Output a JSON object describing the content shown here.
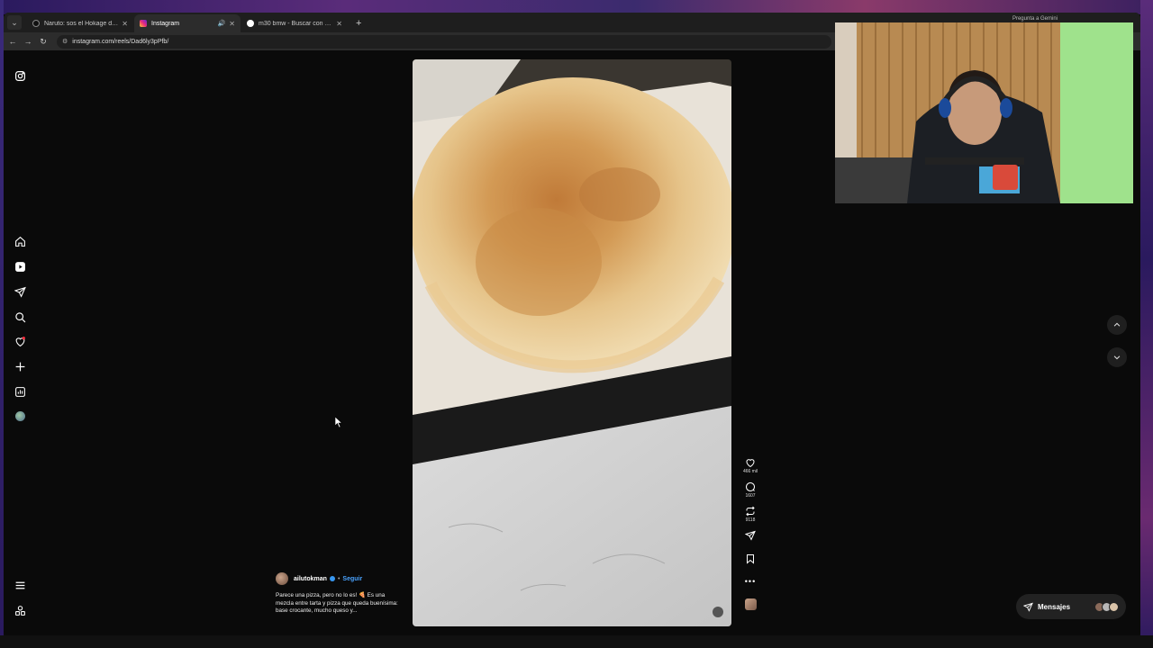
{
  "browser": {
    "tabs": [
      {
        "title": "Naruto: sos el Hokage del stre...",
        "favicon_color": "#1a1a1a",
        "active": false,
        "audio": false
      },
      {
        "title": "Instagram",
        "favicon_color": "#e1306c",
        "active": true,
        "audio": true
      },
      {
        "title": "m30 bmw - Buscar con Google",
        "favicon_color": "#4285f4",
        "active": false,
        "audio": false
      }
    ],
    "new_tab_label": "+",
    "gemini_label": "Pregunta a Gemini",
    "url": "instagram.com/reels/Dad6ly3pPfb/"
  },
  "instagram": {
    "left_nav": [
      {
        "name": "instagram-logo-icon",
        "glyph": "logo"
      },
      {
        "name": "home-icon",
        "glyph": "home"
      },
      {
        "name": "reels-icon",
        "glyph": "reels"
      },
      {
        "name": "direct-icon",
        "glyph": "send"
      },
      {
        "name": "search-icon",
        "glyph": "search"
      },
      {
        "name": "notifications-icon",
        "glyph": "heart"
      },
      {
        "name": "create-icon",
        "glyph": "plus"
      },
      {
        "name": "dashboard-icon",
        "glyph": "chart"
      },
      {
        "name": "profile-avatar-icon",
        "glyph": "avatar"
      },
      {
        "name": "more-menu-icon",
        "glyph": "menu"
      },
      {
        "name": "also-from-meta-icon",
        "glyph": "meta"
      }
    ],
    "reel": {
      "author": "ailutokman",
      "follow_label": "Seguir",
      "caption": "Parece una pizza, pero no lo es! 🍕 Es una mezcla entre tarta y pizza que queda buenísima: base crocante, mucho queso y...",
      "likes": "466 mil",
      "comments": "1607",
      "reposts": "9118"
    },
    "messages_label": "Mensajes"
  }
}
